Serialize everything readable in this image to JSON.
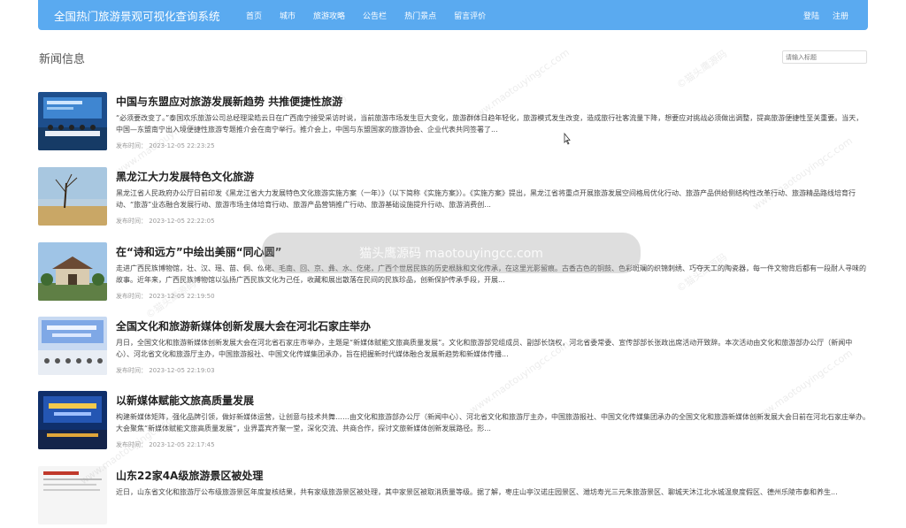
{
  "navbar": {
    "brand": "全国热门旅游景观可视化查询系统",
    "links": [
      "首页",
      "城市",
      "旅游攻略",
      "公告栏",
      "热门景点",
      "留言评价"
    ],
    "login": "登陆",
    "register": "注册",
    "bg_color": "#5aaaf0"
  },
  "page": {
    "title": "新闻信息",
    "search_placeholder": "请输入标题"
  },
  "news": [
    {
      "title": "中国与东盟应对旅游发展新趋势 共推便捷性旅游",
      "summary": "“必须要改变了。”泰国欢乐旅游公司总经理梁皓云日在广西南宁接受采访时说，当前旅游市场发生巨大变化，旅游群体日趋年轻化，旅游模式发生改变，造成旅行社客流量下降，想要应对挑战必须做出调整，提高旅游便捷性至关重要。当天，中国—东盟南宁出入境便捷性旅游专题推介会在南宁举行。推介会上，中国与东盟国家的旅游协会、企业代表共同签署了...",
      "time": "发布时间： 2023-12-05 22:23:25",
      "thumb_icon": "conference-photo"
    },
    {
      "title": "黑龙江大力发展特色文化旅游",
      "summary": "黑龙江省人民政府办公厅日前印发《黑龙江省大力发展特色文化旅游实施方案（一年）》（以下简称《实施方案》）。《实施方案》提出，黑龙江省将重点开展旅游发展空间格局优化行动、旅游产品供给侧结构性改革行动、旅游精品路线培育行动、“旅游”业态融合发展行动、旅游市场主体培育行动、旅游产品营销推广行动、旅游基础设施提升行动、旅游消费创...",
      "time": "发布时间： 2023-12-05 22:22:05",
      "thumb_icon": "lake-tree-photo"
    },
    {
      "title": "在“诗和远方”中绘出美丽“同心圆”",
      "summary": "走进广西民族博物馆，壮、汉、瑶、苗、侗、仫佬、毛南、回、京、彝、水、仡佬，广西个世居民族的历史根脉和文化传承，在这里光影留痕。古香古色的铜鼓、色彩斑斓的织锦刺绣、巧夺天工的陶瓷器，每一件文物背后都有一段耐人寻味的故事。近年来，广西民族博物馆以弘扬广西民族文化为己任，收藏和展出散落在民间的民族珍品，创新保护传承手段，开展...",
      "time": "发布时间： 2023-12-05 22:19:50",
      "thumb_icon": "museum-photo"
    },
    {
      "title": "全国文化和旅游新媒体创新发展大会在河北石家庄举办",
      "summary": "月日，全国文化和旅游新媒体创新发展大会在河北省石家庄市举办，主题是“新媒体赋能文旅高质量发展”。文化和旅游部党组成员、副部长饶权，河北省委常委、宣传部部长张政出席活动开致辞。本次活动由文化和旅游部办公厅（新闻中心）、河北省文化和旅游厅主办，中国旅游报社、中国文化传媒集团承办，旨在把握新时代媒体融合发展新趋势和新媒体传播...",
      "time": "发布时间： 2023-12-05 22:19:03",
      "thumb_icon": "conference-hall-photo"
    },
    {
      "title": "以新媒体赋能文旅高质量发展",
      "summary": "构建新媒体矩阵，强化品牌引领，做好新媒体运营，让创意与技术共舞……由文化和旅游部办公厅（新闻中心）、河北省文化和旅游厅主办，中国旅游报社、中国文化传媒集团承办的全国文化和旅游新媒体创新发展大会日前在河北石家庄举办。大会聚焦“新媒体赋能文旅高质量发展”，业界嘉宾齐聚一堂，深化交流、共商合作，探讨文旅新媒体创新发展路径。形...",
      "time": "发布时间： 2023-12-05 22:17:45",
      "thumb_icon": "stage-photo"
    },
    {
      "title": "山东22家4A级旅游景区被处理",
      "summary": "近日，山东省文化和旅游厅公布级旅游景区年度复核结果，共有家级旅游景区被处理，其中家景区被取消质量等级。据了解，枣庄山亭汉诺庄园景区、潍坊寿光三元朱旅游景区、聊城天沐江北水城温泉度假区、德州乐陵市泰和养生...",
      "time": "",
      "thumb_icon": "document-photo"
    }
  ],
  "watermark": {
    "text1": "©猫头鹰源码",
    "text2": "www.maotouyingcc.com",
    "pill": "猫头鹰源码 maotouyingcc.com"
  }
}
